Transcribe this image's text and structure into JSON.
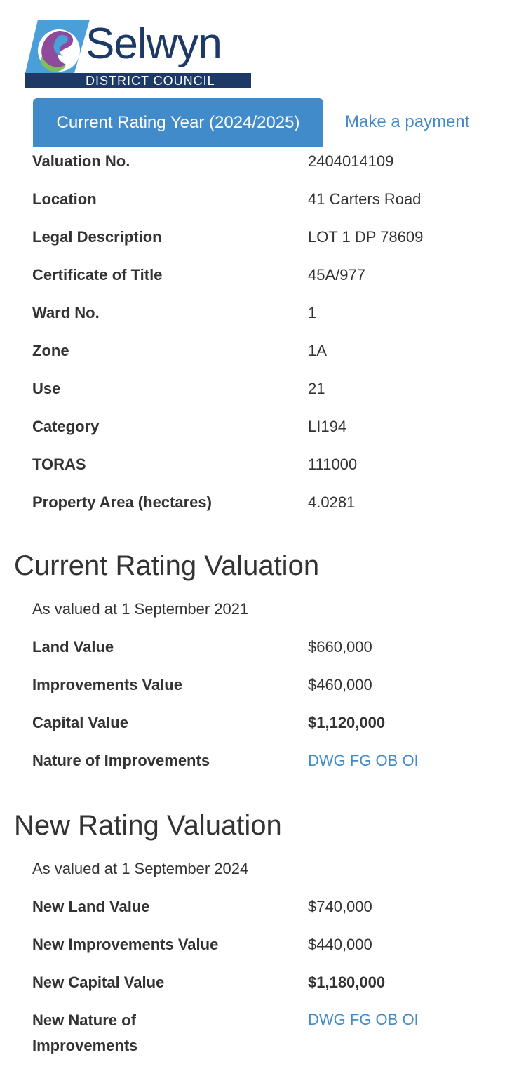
{
  "logo": {
    "name": "Selwyn",
    "subtitle": "DISTRICT COUNCIL",
    "colors": {
      "navy": "#1d3a66",
      "blue": "#4a9fd8",
      "purple": "#8e4a9b",
      "green": "#7cc05a"
    }
  },
  "tabs": {
    "active_label": "Current Rating Year (2024/2025)",
    "payment_label": "Make a payment",
    "accent": "#428bca"
  },
  "property": [
    {
      "label": "Valuation No.",
      "value": "2404014109"
    },
    {
      "label": "Location",
      "value": "41 Carters Road"
    },
    {
      "label": "Legal Description",
      "value": "LOT 1 DP 78609"
    },
    {
      "label": "Certificate of Title",
      "value": "45A/977"
    },
    {
      "label": "Ward No.",
      "value": "1"
    },
    {
      "label": "Zone",
      "value": "1A"
    },
    {
      "label": "Use",
      "value": "21"
    },
    {
      "label": "Category",
      "value": "LI194"
    },
    {
      "label": "TORAS",
      "value": "111000"
    },
    {
      "label": "Property Area (hectares)",
      "value": "4.0281"
    }
  ],
  "current_valuation": {
    "title": "Current Rating Valuation",
    "as_valued": "As valued at 1 September 2021",
    "rows": [
      {
        "label": "Land Value",
        "value": "$660,000"
      },
      {
        "label": "Improvements Value",
        "value": "$460,000"
      },
      {
        "label": "Capital Value",
        "value": "$1,120,000"
      },
      {
        "label": "Nature of Improvements",
        "value": "DWG FG OB OI"
      }
    ]
  },
  "new_valuation": {
    "title": "New Rating Valuation",
    "as_valued": "As valued at 1 September 2024",
    "rows": [
      {
        "label": "New Land Value",
        "value": "$740,000"
      },
      {
        "label": "New Improvements Value",
        "value": "$440,000"
      },
      {
        "label": "New Capital Value",
        "value": "$1,180,000"
      },
      {
        "label": "New Nature of Improvements",
        "value": "DWG FG OB OI"
      }
    ]
  }
}
